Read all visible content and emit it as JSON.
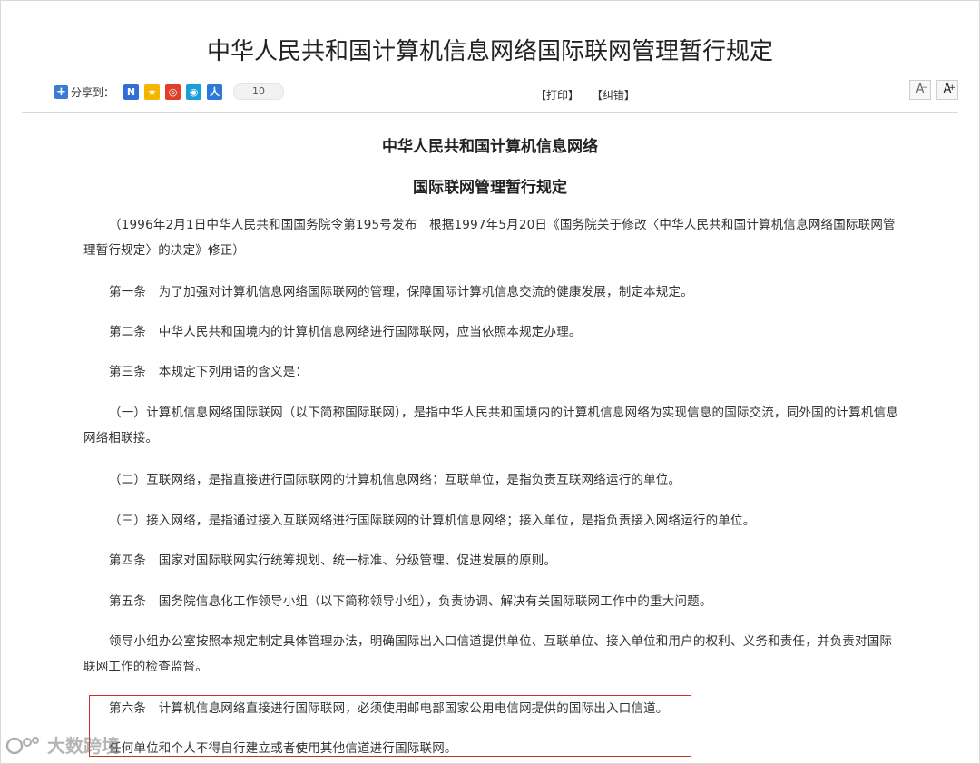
{
  "header": {
    "title": "中华人民共和国计算机信息网络国际联网管理暂行规定"
  },
  "toolbar": {
    "share_label": "分享到：",
    "share_icons": [
      "renren-icon",
      "qzone-icon",
      "weibo-icon",
      "tencent-icon",
      "kaixin-icon"
    ],
    "share_count": "10",
    "print_label": "【打印】",
    "correct_label": "【纠错】",
    "font_decrease": "A",
    "font_increase": "A"
  },
  "document": {
    "title_line1": "中华人民共和国计算机信息网络",
    "title_line2": "国际联网管理暂行规定",
    "paragraphs": [
      "（1996年2月1日中华人民共和国国务院令第195号发布　根据1997年5月20日《国务院关于修改〈中华人民共和国计算机信息网络国际联网管理暂行规定〉的决定》修正）",
      "第一条　为了加强对计算机信息网络国际联网的管理，保障国际计算机信息交流的健康发展，制定本规定。",
      "第二条　中华人民共和国境内的计算机信息网络进行国际联网，应当依照本规定办理。",
      "第三条　本规定下列用语的含义是：",
      "（一）计算机信息网络国际联网（以下简称国际联网），是指中华人民共和国境内的计算机信息网络为实现信息的国际交流，同外国的计算机信息网络相联接。",
      "（二）互联网络，是指直接进行国际联网的计算机信息网络；互联单位，是指负责互联网络运行的单位。",
      "（三）接入网络，是指通过接入互联网络进行国际联网的计算机信息网络；接入单位，是指负责接入网络运行的单位。",
      "第四条　国家对国际联网实行统筹规划、统一标准、分级管理、促进发展的原则。",
      "第五条　国务院信息化工作领导小组（以下简称领导小组），负责协调、解决有关国际联网工作中的重大问题。",
      "领导小组办公室按照本规定制定具体管理办法，明确国际出入口信道提供单位、互联单位、接入单位和用户的权利、义务和责任，并负责对国际联网工作的检查监督。",
      "第六条　计算机信息网络直接进行国际联网，必须使用邮电部国家公用电信网提供的国际出入口信道。",
      "任何单位和个人不得自行建立或者使用其他信道进行国际联网。"
    ]
  },
  "watermark": {
    "text": "大数跨境"
  },
  "colors": {
    "highlight_border": "#c9302c",
    "share_blue": "#3a7bd5"
  }
}
